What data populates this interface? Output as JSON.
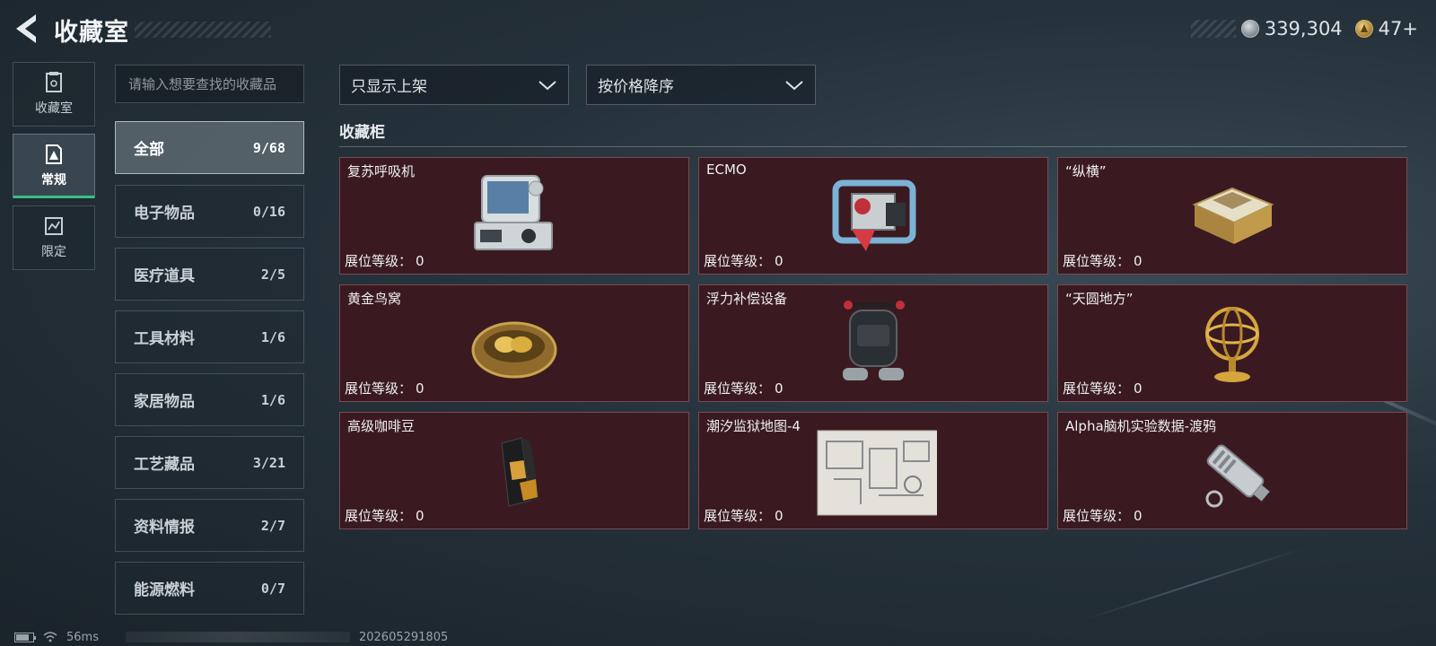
{
  "header": {
    "title": "收藏室",
    "coins": "339,304",
    "tickets": "47+",
    "coin_icon": "silver-coin-icon",
    "ticket_icon": "gold-ticket-icon"
  },
  "nav": {
    "items": [
      {
        "label": "收藏室",
        "icon": "collection-icon"
      },
      {
        "label": "常规",
        "icon": "regular-icon",
        "active": true
      },
      {
        "label": "限定",
        "icon": "limited-icon"
      }
    ]
  },
  "search": {
    "placeholder": "请输入想要查找的收藏品"
  },
  "categories": [
    {
      "name": "全部",
      "count": "9/68",
      "active": true
    },
    {
      "name": "电子物品",
      "count": "0/16"
    },
    {
      "name": "医疗道具",
      "count": "2/5"
    },
    {
      "name": "工具材料",
      "count": "1/6"
    },
    {
      "name": "家居物品",
      "count": "1/6"
    },
    {
      "name": "工艺藏品",
      "count": "3/21"
    },
    {
      "name": "资料情报",
      "count": "2/7"
    },
    {
      "name": "能源燃料",
      "count": "0/7"
    }
  ],
  "filters": {
    "listing": "只显示上架",
    "sort": "按价格降序"
  },
  "section": {
    "title": "收藏柜"
  },
  "level_label": "展位等级：",
  "items": [
    {
      "name": "复苏呼吸机",
      "level": "0"
    },
    {
      "name": "ECMO",
      "level": "0"
    },
    {
      "name": "“纵横”",
      "level": "0"
    },
    {
      "name": "黄金鸟窝",
      "level": "0"
    },
    {
      "name": "浮力补偿设备",
      "level": "0"
    },
    {
      "name": "“天圆地方”",
      "level": "0"
    },
    {
      "name": "高级咖啡豆",
      "level": "0"
    },
    {
      "name": "潮汐监狱地图-4",
      "level": "0"
    },
    {
      "name": "Alpha脑机实验数据-渡鸦",
      "level": "0"
    }
  ],
  "footer": {
    "ping": "56ms",
    "build": "202605291805"
  },
  "colors": {
    "card_bg": "#3a1a20",
    "card_border": "#7a4a51",
    "active_accent": "#35c18b"
  }
}
